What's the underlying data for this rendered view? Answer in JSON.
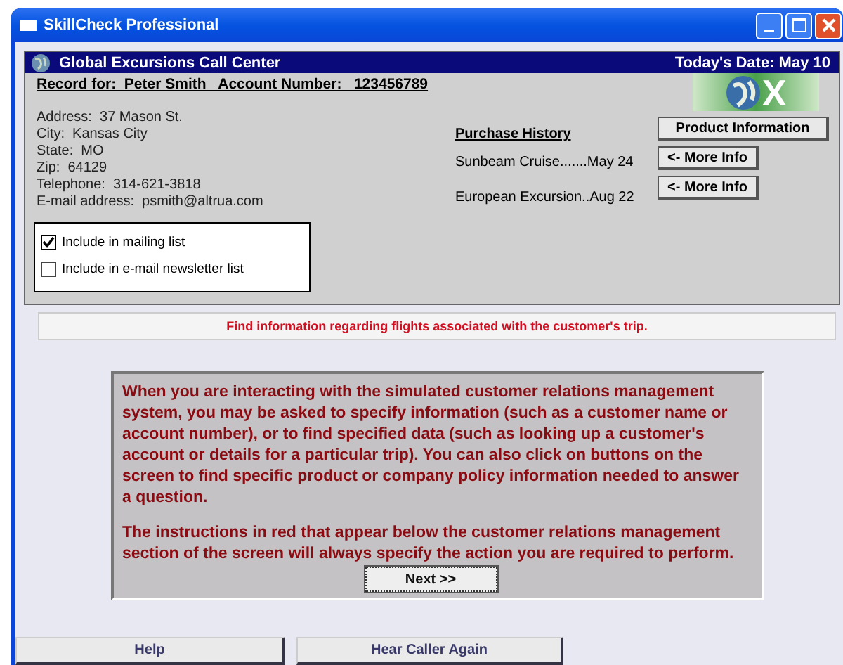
{
  "window": {
    "title": "SkillCheck Professional"
  },
  "header": {
    "title": "Global Excursions Call Center",
    "date": "Today's Date: May 10"
  },
  "record": {
    "label": "Record for:",
    "name": "Peter Smith",
    "account_label": "Account Number:",
    "account": "123456789"
  },
  "logo": {
    "text": "X"
  },
  "address": [
    "Address:  37 Mason St.",
    "City:  Kansas City",
    "State:  MO",
    "Zip:  64129",
    "Telephone:  314-621-3818",
    "E-mail address:  psmith@altrua.com"
  ],
  "options": [
    {
      "label": "Include in mailing list",
      "checked": true
    },
    {
      "label": "Include in e-mail newsletter list",
      "checked": false
    }
  ],
  "purchase_history": {
    "title": "Purchase History",
    "items": [
      {
        "text": "Sunbeam Cruise.......May 24",
        "button": "<- More Info"
      },
      {
        "text": "European Excursion..Aug 22",
        "button": "<- More Info"
      }
    ]
  },
  "product_button": "Product Information",
  "instruction": "Find information regarding flights associated with the customer's trip.",
  "message": {
    "paragraphs": [
      "When you are interacting with the simulated customer relations management system, you may be asked to specify information (such as a customer name or account number), or to find specified data (such as looking up a customer's account or details for a particular trip).  You can also click on buttons on the screen to find specific product or company policy information needed to answer a question.",
      "The instructions in red that appear below the customer relations management section of the screen will always specify the action you are required to perform."
    ],
    "button": "Next >>"
  },
  "footer_buttons": [
    "Help",
    "Hear Caller Again"
  ]
}
